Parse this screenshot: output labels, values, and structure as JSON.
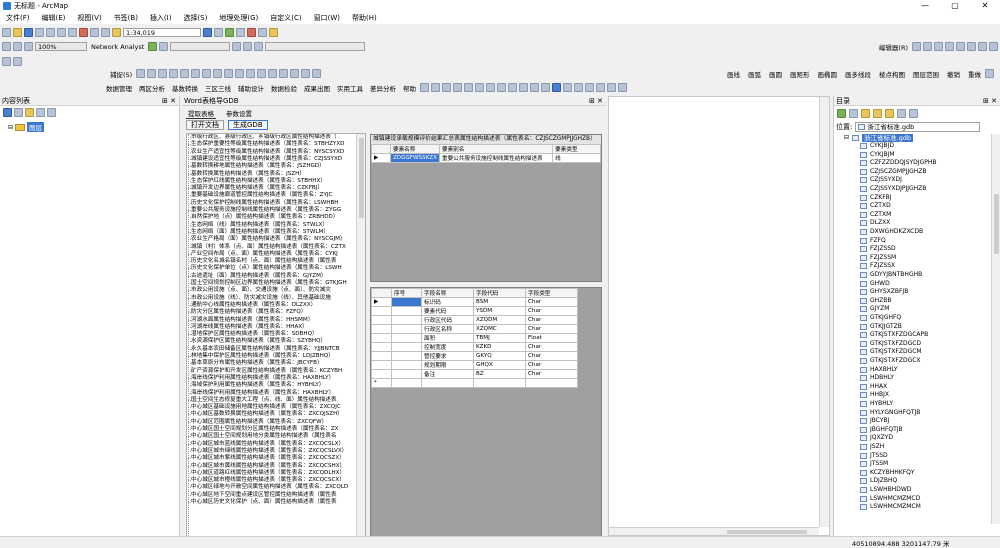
{
  "app": {
    "title": "无标题 - ArcMap"
  },
  "menu": [
    "文件(F)",
    "编辑(E)",
    "视图(V)",
    "书签(B)",
    "插入(I)",
    "选择(S)",
    "地理处理(G)",
    "自定义(C)",
    "窗口(W)",
    "帮助(H)"
  ],
  "toolbar": {
    "scale": "1:34,019",
    "network_analyst": "Network Analyst",
    "editor": "编辑器(R)",
    "zoom": "100%",
    "grid_label": "捕捉(S)",
    "row3": [
      "数据管理",
      "两区分析",
      "基数转换",
      "三区三线",
      "辅助设计",
      "数据检验",
      "成果出图",
      "实用工具",
      "差异分析",
      "帮助"
    ],
    "right_tools": [
      "画线",
      "画弧",
      "画圆",
      "画矩形",
      "画椭圆",
      "画多线段",
      "棱点构图",
      "图层范围",
      "撤销",
      "重做"
    ]
  },
  "toc": {
    "title": "内容列表",
    "layer": "图层"
  },
  "word_panel": {
    "title": "Word表格导GDB",
    "tabs": [
      "提取表格",
      "参数设置"
    ],
    "buttons": [
      "打开文档",
      "生成GDB"
    ],
    "tree_items": [
      "市级行政区、县级行政区、乡镇级行政区属性结构描述表（",
      "生态保护重要性等级属性结构描述表（属性表名：STBHZYXD",
      "农业生产适宜性等级属性结构描述表（属性表名：NYSCSYXD",
      "城镇建设适宜性等级属性结构描述表（属性表名：CZJSSYXD",
      "基数转换耕地属性结构描述表（属性表名：JSZHGD）",
      "基数转换属性结构描述表（属性表名：JSZH）",
      "生态保护红线属性结构描述表（属性表名：STBHHX）",
      "城镇开发边界属性结构描述表（属性表名：CZKFBJ）",
      "重要基础设施廊道管控属性结构描述表（属性表名：ZYJC",
      "历史文化保护控制线属性结构描述表（属性表名：LSWHBH",
      "重要公共服务设施控制线属性结构描述表（属性表名：ZYGG",
      "自然保护地（点）属性结构描述表（属性表名：ZRBHDD）",
      "生态网络（线）属性结构描述表（属性表名：STWLX）",
      "生态网络（面）属性结构描述表（属性表名：STWLM）",
      "农业生产格局（面）属性结构描述表（属性表名：NYSCGJM）",
      "城镇（村）体系（点、面）属性结构描述表（属性表名：CZTX",
      "产业空间布局（点、面）属性结构描述表（属性表名：CYKJ",
      "历史文化名城名镇名村（点、面）属性结构描述表（属性表",
      "历史文化保护单位（点）属性结构描述表（属性表名：LSWH",
      "古迹遗址（面）属性结构描述表（属性表名：GJYZM）",
      "国土空间规划控制区边界属性结构描述表（属性表名：GTKJGH",
      "市政公用设施（点、面）、交通设施（点、面）、防灾减灾",
      "市政公用设施（线）、防灾减灾设施（线）、其他基础设施",
      "通航中心线属性结构描述表（属性表名：DLZXX）",
      "防灾分区属性结构描述表（属性表名：FZFQ）",
      "河湖水面属性结构描述表（属性表名：HHSMM）",
      "河湖岸线属性结构描述表（属性表名：HHAX）",
      "湿地保护区属性结构描述表（属性表名：SDBHQ）",
      "水资源保护区属性结构描述表（属性表名：SZYBHQ）",
      "永久基本农田储备区属性结构描述表（属性表名：YJJBNTCB",
      "林地集中保护区属性结构描述表（属性表名：LDJZBHQ）",
      "基本草原分布属性结构描述表（属性表名：JBCYFB）",
      "矿产资源保护和开发区属性结构描述表（属性表名：KCZYBH",
      "海岸线保护利用属性结构描述表（属性表名：HAXBHLY）",
      "海域保护利用属性结构描述表（属性表名：HYBHLY）",
      "海岸线保护利用属性结构描述表（属性表名：HAXBHLY）",
      "国土空间生态修复重大工程（点、线、面）属性结构描述表",
      "中心城区基础设施用地属性结构描述表（属性表名：ZXCQJC",
      "中心城区基数转换属性结构描述表（属性表名：ZXCQJSZH）",
      "中心城区范围属性结构描述表（属性表名：ZXCQFW）",
      "中心城区国土空间规划分区属性结构描述表（属性表名：ZX",
      "中心城区国土空间规划用地分类属性结构描述表（属性表名",
      "中心城区城市蓝线属性结构描述表（属性表名：ZXCQCSLX）",
      "中心城区城市绿线属性结构描述表（属性表名：ZXCQCSLVX）",
      "中心城区城市紫线属性结构描述表（属性表名：ZXCQCSZX）",
      "中心城区城市黄线属性结构描述表（属性表名：ZXCQCSHX）",
      "中心城区道路红线属性结构描述表（属性表名：ZXCQDLHX）",
      "中心城区城市橙线属性结构描述表（属性表名：ZXCQCSCX）",
      "中心城区绿地与开敞空间属性结构描述表（属性表名：ZXCQLD",
      "中心城区地下空间重点建设区管控属性结构描述表（属性表",
      "中心城区历史文化保护（点、面）属性结构描述表（属性表"
    ],
    "grid1": {
      "caption": "城镇建设承载规模评价结果汇总表属性结构描述表（属性表名：CZJSCZGMPJJGHZB）",
      "headers": [
        "",
        "要素名称",
        "要素别名",
        "要素类型"
      ],
      "row": [
        "▶",
        "ZDGGFWSSKZX",
        "重要公共服务设施控制线属性结构描述表",
        "线"
      ]
    },
    "grid2": {
      "headers": [
        "",
        "序号",
        "字段名称",
        "字段代码",
        "字段类型"
      ],
      "rows": [
        [
          "▶",
          "",
          "标识码",
          "BSM",
          "Char"
        ],
        [
          "",
          "",
          "要素代码",
          "YSDM",
          "Char"
        ],
        [
          "",
          "",
          "行政区代码",
          "XZQDM",
          "Char"
        ],
        [
          "",
          "",
          "行政区名称",
          "XZQMC",
          "Char"
        ],
        [
          "",
          "",
          "面积",
          "TBMJ",
          "Float"
        ],
        [
          "",
          "",
          "控制宽度",
          "KZKD",
          "Char"
        ],
        [
          "",
          "",
          "管控要求",
          "GKYQ",
          "Char"
        ],
        [
          "",
          "",
          "规划期限",
          "GHQX",
          "Char"
        ],
        [
          "",
          "",
          "备注",
          "BZ",
          "Char"
        ],
        [
          "*",
          "",
          "",
          "",
          ""
        ]
      ]
    }
  },
  "catalog": {
    "title": "目录",
    "location_label": "位置:",
    "location_value": "浙江省标准.gdb",
    "root": "浙江省标准.gdb",
    "items": [
      "CYKJBJD",
      "CYKJBJM",
      "CZFZZDDQJSYDJGPHB",
      "CZJSCZGMPJJGHZB",
      "CZJSSYXDJ",
      "CZJSSYXDJPJJGHZB",
      "CZKFBJ",
      "CZTXD",
      "CZTXM",
      "DLZXX",
      "DXWGHDKZXCDB",
      "FZFQ",
      "FZJZSSD",
      "FZJZSSM",
      "FZJZSSX",
      "GDYYJBNTBHGHB",
      "GHWD",
      "GHYSXZBFJB",
      "GHZBB",
      "GJYZM",
      "GTKJGHFQ",
      "GTKJJGTZB",
      "GTKJSTXFZDGCAPB",
      "GTKJSTXFZDGCD",
      "GTKJSTXFZDGCM",
      "GTKJSTXFZDGCX",
      "HAXBHLY",
      "HDBHLY",
      "HHAX",
      "HHBJX",
      "HYBHLY",
      "HYLYGNGHFQTJB",
      "JBCYBJ",
      "JBGHFQTJB",
      "JQXZYD",
      "JSZH",
      "JTSSD",
      "JTSSM",
      "KCZYBHHKFQY",
      "LDJZBHQ",
      "LSWHBHDWD",
      "LSWHMCMZMCD",
      "LSWHMCMZMCM"
    ]
  },
  "status": {
    "coords": "40510894.488  3201147.79 米"
  }
}
